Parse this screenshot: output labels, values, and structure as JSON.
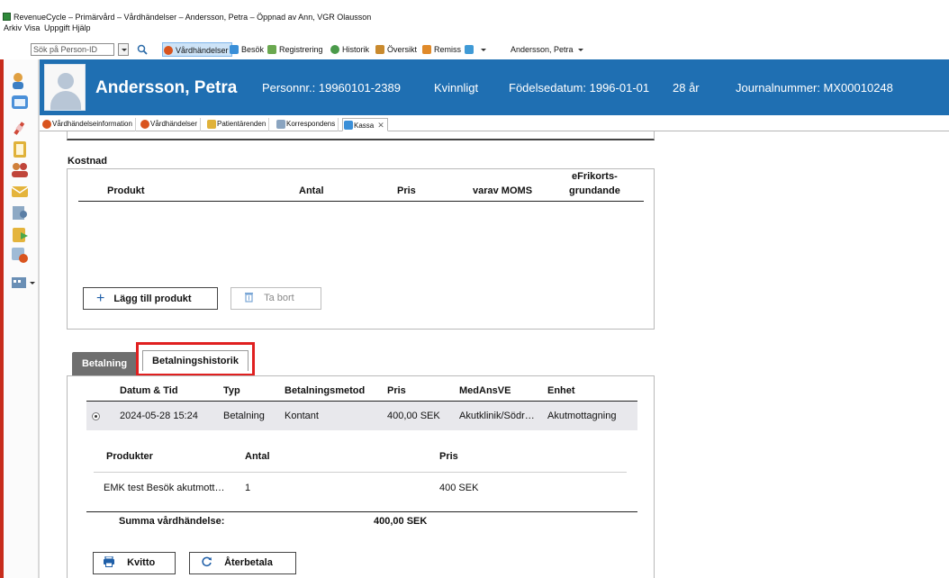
{
  "window": {
    "title": "RevenueCycle – Primärvård – Vårdhändelser – Andersson, Petra – Öppnad av Ann, VGR Olausson"
  },
  "menu": [
    "Arkiv",
    "Visa",
    "Uppgift",
    "Hjälp"
  ],
  "toolbar": {
    "search_placeholder": "Sök på Person-ID",
    "buttons": [
      "Vårdhändelser",
      "Besök",
      "Registrering",
      "Historik",
      "Översikt",
      "Remiss"
    ],
    "patient_selector": "Andersson, Petra"
  },
  "patient": {
    "name": "Andersson, Petra",
    "personnr": "Personnr.: 19960101-2389",
    "gender": "Kvinnligt",
    "birthdate": "Födelsedatum: 1996-01-01",
    "age": "28 år",
    "journal": "Journalnummer: MX00010248"
  },
  "tabs": [
    "Vårdhändelseinformation",
    "Vårdhändelser",
    "Patientärenden",
    "Korrespondens",
    "Kassa"
  ],
  "cost": {
    "title": "Kostnad",
    "columns": {
      "produkt": "Produkt",
      "antal": "Antal",
      "pris": "Pris",
      "moms": "varav MOMS",
      "efrikort_1": "eFrikorts-",
      "efrikort_2": "grundande"
    },
    "add_button": "Lägg till produkt",
    "remove_button": "Ta bort"
  },
  "payment_tabs": {
    "betalning": "Betalning",
    "historik": "Betalningshistorik"
  },
  "history": {
    "columns": {
      "datum": "Datum & Tid",
      "typ": "Typ",
      "metod": "Betalningsmetod",
      "pris": "Pris",
      "medansve": "MedAnsVE",
      "enhet": "Enhet"
    },
    "row": {
      "datum": "2024-05-28 15:24",
      "typ": "Betalning",
      "metod": "Kontant",
      "pris": "400,00 SEK",
      "medansve": "Akutklinik/Södr…",
      "enhet": "Akutmottagning"
    },
    "product_columns": {
      "produkter": "Produkter",
      "antal": "Antal",
      "pris": "Pris"
    },
    "product_row": {
      "produkt": "EMK test Besök akutmott…",
      "antal": "1",
      "pris": "400 SEK"
    },
    "sum_label": "Summa vårdhändelse:",
    "sum_value": "400,00 SEK"
  },
  "actions": {
    "kvitto": "Kvitto",
    "aterbetala": "Återbetala"
  },
  "colors": {
    "header_bg": "#1f6fb2",
    "highlight": "#e02020",
    "selected_row": "#e8e8ec",
    "active_tab": "#6f6f6f"
  }
}
